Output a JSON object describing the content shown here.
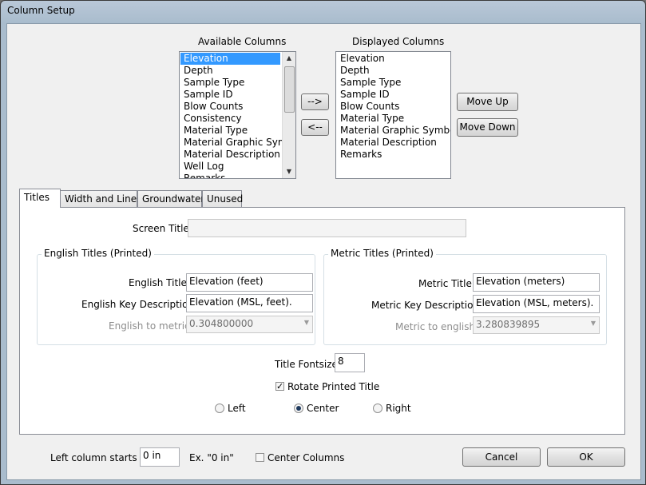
{
  "window": {
    "title": "Column Setup"
  },
  "available": {
    "label": "Available Columns",
    "items": [
      "Elevation",
      "Depth",
      "Sample Type",
      "Sample ID",
      "Blow Counts",
      "Consistency",
      "Material Type",
      "Material Graphic Sym...",
      "Material Description",
      "Well Log",
      "Remarks"
    ],
    "selected_index": 0
  },
  "displayed": {
    "label": "Displayed Columns",
    "items": [
      "Elevation",
      "Depth",
      "Sample Type",
      "Sample ID",
      "Blow Counts",
      "Material Type",
      "Material Graphic Symbol",
      "Material Description",
      "Remarks"
    ]
  },
  "buttons": {
    "add": "-->",
    "remove": "<--",
    "move_up": "Move Up",
    "move_down": "Move Down",
    "cancel": "Cancel",
    "ok": "OK"
  },
  "tabs": [
    "Titles",
    "Width and Lines",
    "Groundwater",
    "Unused"
  ],
  "titles": {
    "screen_title_label": "Screen Title:",
    "screen_title_value": "",
    "english_group": "English Titles (Printed)",
    "english_title_label": "English Title:",
    "english_title_value": "Elevation (feet)",
    "english_key_label": "English Key Description:",
    "english_key_value": "Elevation (MSL, feet).",
    "english_to_metric_label": "English to metric:",
    "english_to_metric_value": "0.304800000",
    "metric_group": "Metric Titles (Printed)",
    "metric_title_label": "Metric Title:",
    "metric_title_value": "Elevation (meters)",
    "metric_key_label": "Metric Key Description:",
    "metric_key_value": "Elevation (MSL, meters).",
    "metric_to_english_label": "Metric to english:",
    "metric_to_english_value": "3.280839895",
    "fontsize_label": "Title Fontsize:",
    "fontsize_value": "8",
    "rotate_label": "Rotate Printed Title",
    "rotate_checked": true,
    "align_left": "Left",
    "align_center": "Center",
    "align_right": "Right",
    "align_selected": "Center"
  },
  "footer": {
    "left_col_label": "Left column starts at:",
    "left_col_value": "0 in",
    "example": "Ex. \"0 in\"",
    "center_columns_label": "Center Columns",
    "center_columns_checked": false
  }
}
